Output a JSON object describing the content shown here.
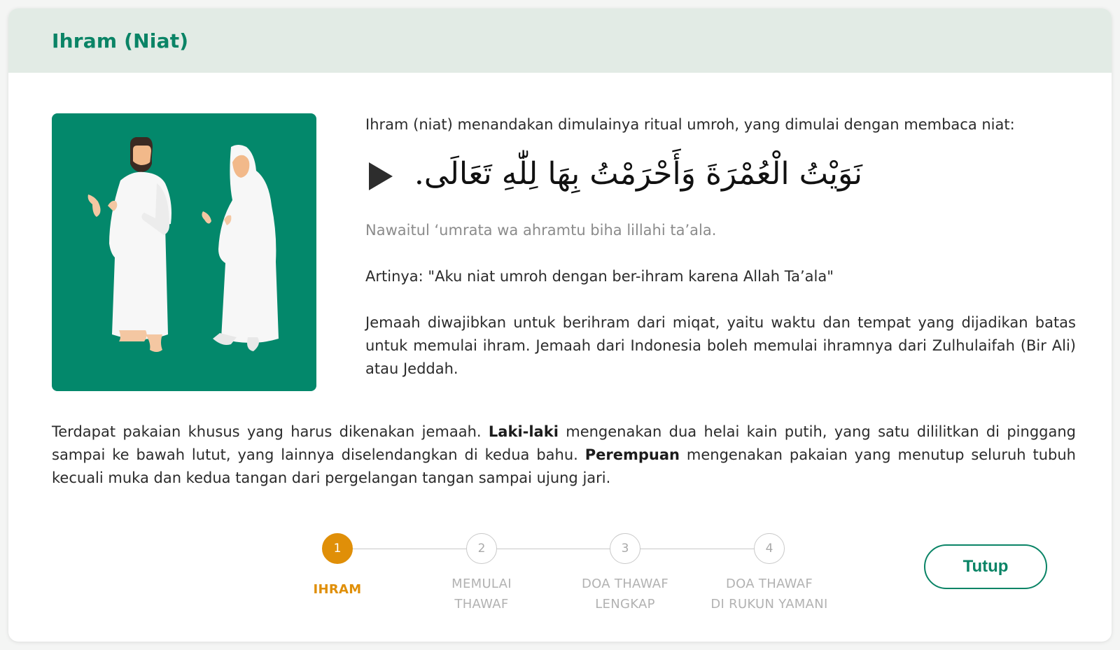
{
  "modal": {
    "title": "Ihram (Niat)"
  },
  "content": {
    "intro": "Ihram (niat) menandakan dimulainya ritual umroh, yang dimulai dengan membaca niat:",
    "arabic": "نَوَيْتُ الْعُمْرَةَ وَأَحْرَمْتُ بِهَا لِلّٰهِ تَعَالَى.",
    "transliteration": "Nawaitul ‘umrata wa ahramtu biha lillahi ta’ala.",
    "meaning": "Artinya: \"Aku niat umroh dengan ber-ihram karena Allah Ta’ala\"",
    "miqat": "Jemaah diwajibkan untuk berihram dari miqat, yaitu waktu dan tempat yang dijadikan batas untuk memulai ihram. Jemaah dari Indonesia boleh memulai ihramnya dari Zulhulaifah (Bir Ali) atau Jeddah.",
    "clothing": {
      "part1": "Terdapat pakaian khusus yang harus dikenakan jemaah. ",
      "men_bold": "Laki-laki",
      "part2": " mengenakan dua helai kain putih, yang satu dililitkan di pinggang sampai ke bawah lutut, yang lainnya diselendangkan di kedua bahu. ",
      "women_bold": "Perempuan",
      "part3": " mengenakan pakaian yang menutup seluruh tubuh kecuali muka dan kedua tangan dari pergelangan tangan sampai ujung jari."
    }
  },
  "stepper": {
    "active_index": 0,
    "steps": [
      {
        "number": "1",
        "line1": "IHRAM",
        "line2": ""
      },
      {
        "number": "2",
        "line1": "MEMULAI",
        "line2": "THAWAF"
      },
      {
        "number": "3",
        "line1": "DOA THAWAF",
        "line2": "LENGKAP"
      },
      {
        "number": "4",
        "line1": "DOA THAWAF",
        "line2": "DI RUKUN YAMANI"
      }
    ]
  },
  "actions": {
    "close_label": "Tutup"
  },
  "icons": {
    "play": "play-icon"
  },
  "colors": {
    "brand_green": "#0a8466",
    "header_bg": "#e2ebe5",
    "illustration_bg": "#03886b",
    "active_step": "#e08f08",
    "muted_text": "#8b8b8b"
  }
}
